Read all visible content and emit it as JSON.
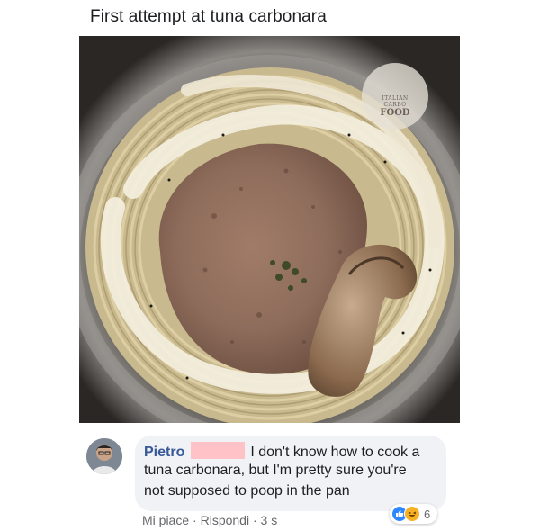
{
  "post": {
    "text": "First attempt at tuna carbonara"
  },
  "photo": {
    "watermark": {
      "line1": "ITALIAN",
      "line2": "CARBO",
      "line3": "FOOD"
    }
  },
  "comment": {
    "author": "Pietro",
    "line1": "I don't know how to cook a",
    "line2": "tuna carbonara, but I'm pretty sure you're",
    "line3": "not supposed to poop in the pan",
    "reactions": {
      "icons": [
        "like-icon",
        "haha-icon"
      ],
      "count": "6"
    },
    "actions": {
      "like": "Mi piace",
      "separator": "·",
      "reply": "Rispondi",
      "time": "3 s"
    }
  },
  "colors": {
    "author_link": "#385898",
    "bubble_bg": "#f0f2f5",
    "like_blue": "#2d88ff",
    "haha_yellow": "#f7b125",
    "redaction_pink": "#ffc2c6"
  }
}
